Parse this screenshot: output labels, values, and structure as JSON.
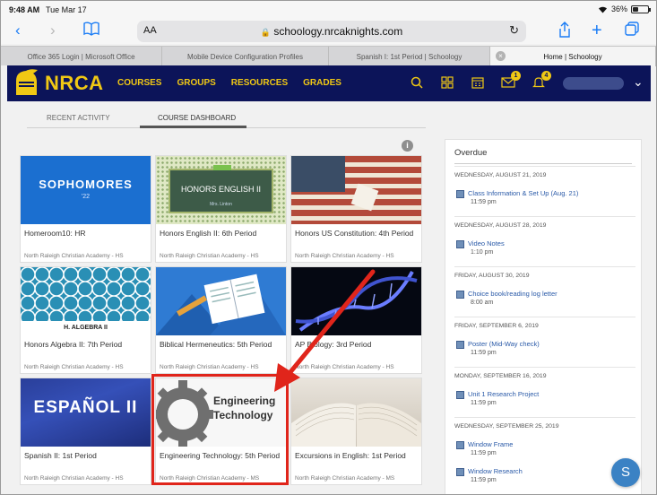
{
  "status": {
    "time": "9:48 AM",
    "date": "Tue Mar 17",
    "battery": "36%",
    "battery_level": 0.36
  },
  "browser": {
    "aa": "AA",
    "url": "schoology.nrcaknights.com",
    "tabs": [
      {
        "label": "Office 365 Login | Microsoft Office",
        "active": false
      },
      {
        "label": "Mobile Device Configuration Profiles",
        "active": false
      },
      {
        "label": "Spanish I: 1st Period | Schoology",
        "active": false
      },
      {
        "label": "Home | Schoology",
        "active": true
      }
    ]
  },
  "header": {
    "brand": "NRCA",
    "nav": [
      "COURSES",
      "GROUPS",
      "RESOURCES",
      "GRADES"
    ],
    "mail_badge": "1",
    "notif_badge": "4",
    "colors": {
      "navy": "#0c1459",
      "gold": "#f0c814"
    }
  },
  "subtabs": {
    "recent": "RECENT ACTIVITY",
    "dashboard": "COURSE DASHBOARD"
  },
  "courses": [
    {
      "title": "Homeroom10: HR",
      "school": "North Raleigh Christian Academy - HS",
      "img_text": "SOPHOMORES",
      "img_sub": "'22"
    },
    {
      "title": "Honors English II: 6th Period",
      "school": "North Raleigh Christian Academy - HS",
      "img_text": "HONORS ENGLISH II",
      "img_sub": "Mrs. Linton"
    },
    {
      "title": "Honors US Constitution: 4th Period",
      "school": "North Raleigh Christian Academy - HS",
      "img_text": "",
      "img_sub": ""
    },
    {
      "title": "Honors Algebra II: 7th Period",
      "school": "North Raleigh Christian Academy - HS",
      "img_text": "H. ALGEBRA II",
      "img_sub": ""
    },
    {
      "title": "Biblical Hermeneutics: 5th Period",
      "school": "North Raleigh Christian Academy - HS",
      "img_text": "",
      "img_sub": ""
    },
    {
      "title": "AP Biology: 3rd Period",
      "school": "North Raleigh Christian Academy - HS",
      "img_text": "",
      "img_sub": ""
    },
    {
      "title": "Spanish II: 1st Period",
      "school": "North Raleigh Christian Academy - HS",
      "img_text": "ESPAÑOL II",
      "img_sub": ""
    },
    {
      "title": "Engineering Technology: 5th Period",
      "school": "North Raleigh Christian Academy - MS",
      "img_text": "Engineering",
      "img_sub": "Technology"
    },
    {
      "title": "Excursions in English: 1st Period",
      "school": "North Raleigh Christian Academy - MS",
      "img_text": "",
      "img_sub": ""
    }
  ],
  "overdue": {
    "heading": "Overdue",
    "groups": [
      {
        "date": "WEDNESDAY, AUGUST 21, 2019",
        "items": [
          {
            "name": "Class Information & Set Up (Aug. 21)",
            "time": "11:59 pm"
          }
        ]
      },
      {
        "date": "WEDNESDAY, AUGUST 28, 2019",
        "items": [
          {
            "name": "Video Notes",
            "time": "1:10 pm"
          }
        ]
      },
      {
        "date": "FRIDAY, AUGUST 30, 2019",
        "items": [
          {
            "name": "Choice book/reading log letter",
            "time": "8:00 am"
          }
        ]
      },
      {
        "date": "FRIDAY, SEPTEMBER 6, 2019",
        "items": [
          {
            "name": "Poster (Mid-Way check)",
            "time": "11:59 pm"
          }
        ]
      },
      {
        "date": "MONDAY, SEPTEMBER 16, 2019",
        "items": [
          {
            "name": "Unit 1 Research Project",
            "time": "11:59 pm"
          }
        ]
      },
      {
        "date": "WEDNESDAY, SEPTEMBER 25, 2019",
        "items": [
          {
            "name": "Window Frame",
            "time": "11:59 pm"
          },
          {
            "name": "Window Research",
            "time": "11:59 pm"
          }
        ]
      }
    ]
  },
  "fab": "S"
}
